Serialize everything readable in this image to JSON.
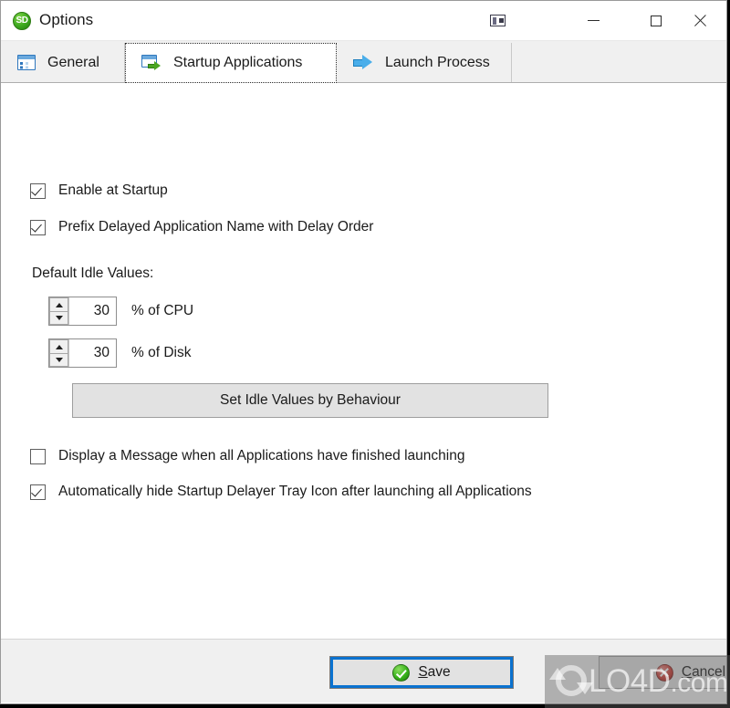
{
  "window": {
    "title": "Options",
    "app_icon": "SD",
    "app_icon_name": "startup-delayer-logo",
    "controls": {
      "dock": "dock-panel-icon",
      "minimize": "minimize-icon",
      "maximize": "maximize-icon",
      "close": "close-icon"
    }
  },
  "tabs": [
    {
      "label": "General",
      "icon": "window-form-icon",
      "active": false
    },
    {
      "label": "Startup Applications",
      "icon": "window-green-arrow-icon",
      "active": true
    },
    {
      "label": "Launch Process",
      "icon": "blue-arrow-icon",
      "active": false
    }
  ],
  "main": {
    "checkboxes": [
      {
        "label": "Enable at Startup",
        "checked": true
      },
      {
        "label": "Prefix Delayed Application Name with Delay Order",
        "checked": true
      }
    ],
    "idle_section": {
      "title": "Default Idle Values:",
      "fields": [
        {
          "value": "30",
          "unit": "% of CPU"
        },
        {
          "value": "30",
          "unit": "% of Disk"
        }
      ],
      "behaviour_button": "Set Idle Values by Behaviour"
    },
    "checkboxes_bottom": [
      {
        "label": "Display a Message when all Applications have finished launching",
        "checked": false
      },
      {
        "label": "Automatically hide Startup Delayer Tray Icon after launching all Applications",
        "checked": true
      }
    ]
  },
  "footer": {
    "save": {
      "label": "Save",
      "accel": "S",
      "icon": "green-check-circle-icon"
    },
    "cancel": {
      "label": "Cancel",
      "accel": "C",
      "icon": "red-x-circle-icon"
    }
  },
  "watermark": {
    "text": "LO4D",
    "suffix": ".com",
    "logo": "refresh-arrows-icon"
  },
  "colors": {
    "accent_focus": "#0a72d0",
    "tab_active_bg": "#ffffff",
    "tab_bg": "#f0f0f0",
    "button_bg": "#e2e2e2",
    "icon_green": "#38b31a",
    "icon_red": "#cf3a32",
    "icon_blue": "#4aaeea"
  }
}
